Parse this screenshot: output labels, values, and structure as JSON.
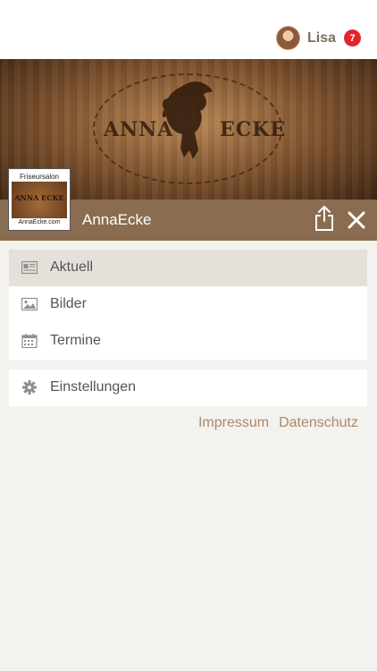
{
  "user": {
    "name": "Lisa",
    "notification_count": "7"
  },
  "banner": {
    "logo_left": "ANNA",
    "logo_right": "ECKE"
  },
  "salon_logo": {
    "top_text": "Friseursalon",
    "middle_text": "ANNA ECKE",
    "bottom_text": "AnnaEcke.com"
  },
  "header": {
    "title": "AnnaEcke"
  },
  "menu": {
    "main": [
      {
        "label": "Aktuell",
        "icon": "newspaper-icon",
        "active": true
      },
      {
        "label": "Bilder",
        "icon": "image-icon",
        "active": false
      },
      {
        "label": "Termine",
        "icon": "calendar-icon",
        "active": false
      }
    ],
    "settings": {
      "label": "Einstellungen",
      "icon": "gear-icon"
    }
  },
  "footer": {
    "impressum": "Impressum",
    "datenschutz": "Datenschutz"
  },
  "colors": {
    "header_bg": "#8a6d50",
    "active_bg": "#e5e0d9",
    "badge": "#e0262b",
    "link": "#a8896b",
    "page_bg": "#f4f2ef"
  }
}
